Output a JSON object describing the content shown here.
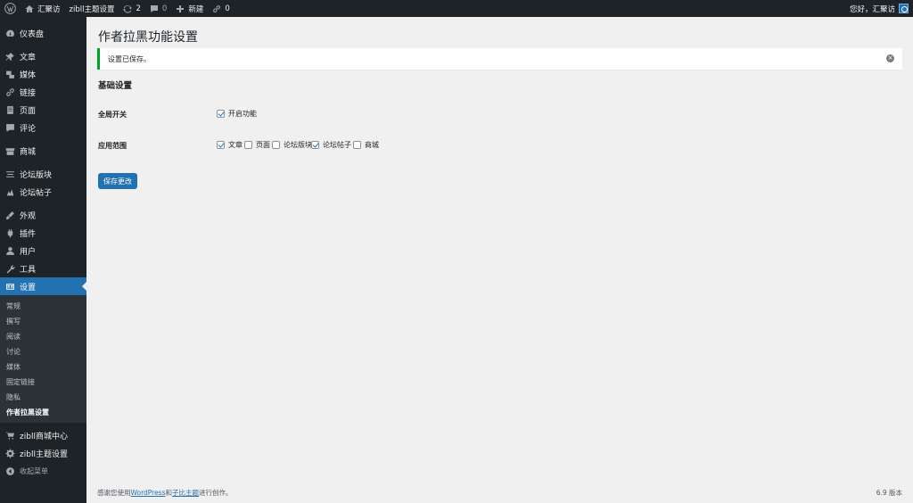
{
  "adminbar": {
    "site_name": "汇聚访",
    "theme_settings": "zibll主题设置",
    "updates_count": "2",
    "comments_count": "0",
    "new_label": "新建",
    "links_count": "0",
    "greeting": "您好，汇聚访"
  },
  "sidebar": {
    "dashboard": "仪表盘",
    "posts": "文章",
    "media": "媒体",
    "links": "链接",
    "pages": "页面",
    "comments": "评论",
    "shop": "商城",
    "forum_plates": "论坛版块",
    "forum_posts": "论坛帖子",
    "appearance": "外观",
    "plugins": "插件",
    "users": "用户",
    "tools": "工具",
    "settings": "设置",
    "submenu": [
      "常规",
      "撰写",
      "阅读",
      "讨论",
      "媒体",
      "固定链接",
      "隐私",
      "作者拉黑设置"
    ],
    "zibll_shop": "zibll商城中心",
    "zibll_theme": "zibll主题设置",
    "collapse": "收起菜单"
  },
  "main": {
    "title": "作者拉黑功能设置",
    "notice": "设置已保存。",
    "section": "基础设置",
    "global_switch_label": "全局开关",
    "global_switch_option": "开启功能",
    "scope_label": "应用范围",
    "scope_options": [
      "文章",
      "页面",
      "论坛版块",
      "论坛帖子",
      "商城"
    ],
    "save_button": "保存更改"
  },
  "footer": {
    "thanks_prefix": "感谢您使用",
    "wordpress": "WordPress",
    "and": "和",
    "theme_link": "子比主题",
    "suffix": "进行创作。",
    "version": "6.9 版本"
  },
  "colors": {
    "accent": "#2271b1",
    "sidebar_bg": "#1d2327",
    "success": "#00a32a"
  }
}
